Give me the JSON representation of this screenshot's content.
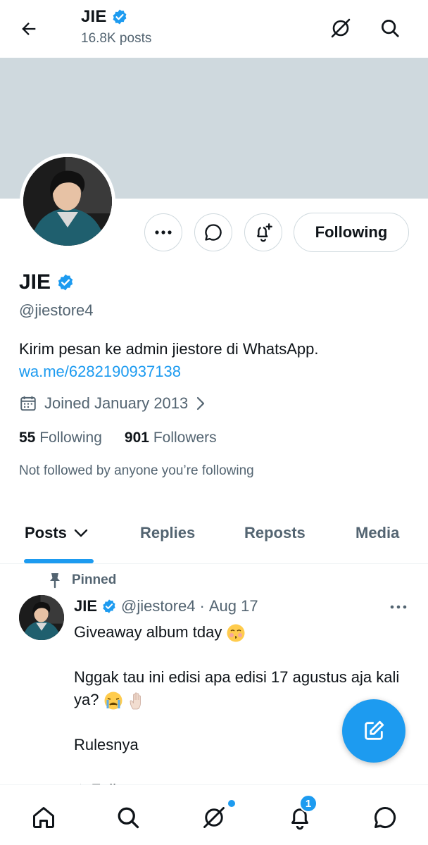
{
  "header": {
    "name": "JIE",
    "posts_count": "16.8K posts"
  },
  "profile": {
    "name": "JIE",
    "handle": "@jiestore4",
    "bio_text": "Kirim pesan ke admin jiestore di WhatsApp.",
    "bio_link": "wa.me/6282190937138",
    "joined": "Joined January 2013",
    "following_count": "55",
    "following_label": "Following",
    "followers_count": "901",
    "followers_label": "Followers",
    "not_followed": "Not followed by anyone you’re following",
    "follow_button": "Following"
  },
  "tabs": [
    {
      "label": "Posts"
    },
    {
      "label": "Replies"
    },
    {
      "label": "Reposts"
    },
    {
      "label": "Media"
    }
  ],
  "tweet": {
    "pinned_label": "Pinned",
    "author": "JIE",
    "handle": "@jiestore4",
    "separator": "·",
    "date": "Aug 17",
    "line1": "Giveaway album tday",
    "line2": "Nggak tau ini edisi apa edisi 17 agustus aja kali ya?",
    "line3": "Rulesnya",
    "line4": "✦ Foll..."
  },
  "nav": {
    "notification_badge": "1"
  },
  "colors": {
    "accent": "#1d9bf0",
    "banner": "#cfd9de",
    "secondary_text": "#536471"
  },
  "icons": [
    "back-arrow-icon",
    "grok-icon",
    "search-icon",
    "verified-badge-icon",
    "more-icon",
    "message-icon",
    "notification-plus-icon",
    "calendar-icon",
    "chevron-right-icon",
    "chevron-down-icon",
    "pin-icon",
    "compose-icon",
    "home-icon",
    "bell-icon",
    "chat-icon"
  ]
}
